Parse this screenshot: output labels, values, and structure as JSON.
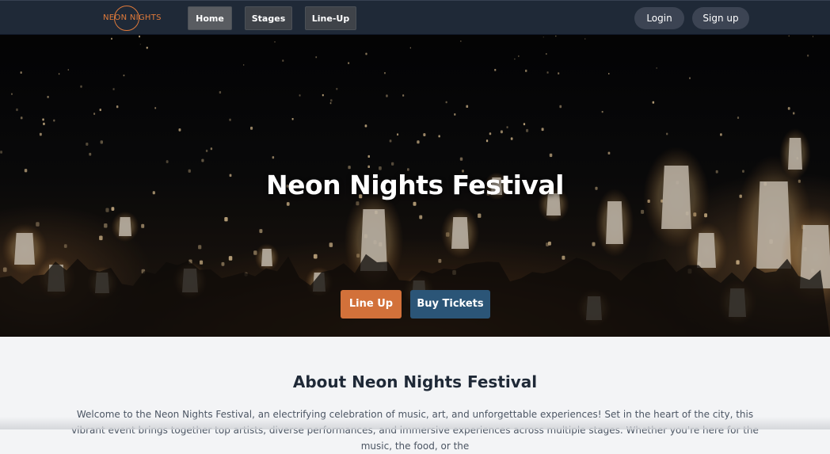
{
  "brand": {
    "logo_text": "NEON NIGHTS",
    "accent_color": "#e07a3a"
  },
  "nav": {
    "links": [
      {
        "label": "Home",
        "active": true
      },
      {
        "label": "Stages",
        "active": false
      },
      {
        "label": "Line-Up",
        "active": false
      }
    ],
    "login_label": "Login",
    "signup_label": "Sign up"
  },
  "hero": {
    "title": "Neon Nights Festival",
    "lineup_button": "Line Up",
    "tickets_button": "Buy Tickets",
    "lineup_color": "#d2713a",
    "tickets_color": "#2b5577"
  },
  "about": {
    "heading": "About Neon Nights Festival",
    "body": "Welcome to the Neon Nights Festival, an electrifying celebration of music, art, and unforgettable experiences! Set in the heart of the city, this vibrant event brings together top artists, diverse performances, and immersive experiences across multiple stages. Whether you're here for the music, the food, or the"
  }
}
